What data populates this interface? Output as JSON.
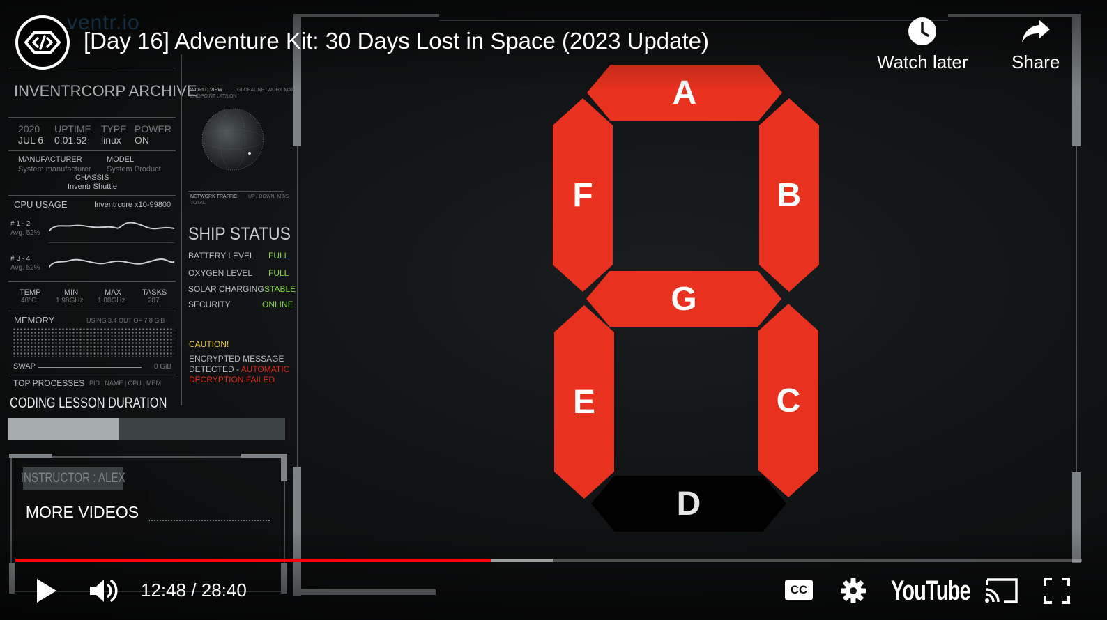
{
  "player": {
    "title": "[Day 16] Adventure Kit: 30 Days Lost in Space (2023 Update)",
    "watch_later_label": "Watch later",
    "share_label": "Share",
    "more_videos_label": "MORE VIDEOS",
    "current_time": "12:48",
    "duration": "28:40",
    "time_separator": " / ",
    "progress_played": 0.446,
    "progress_buffered": 0.504,
    "youtube_logo_text": "YouTube",
    "cc_label": "CC",
    "accent_color": "#ff0000"
  },
  "watermark": {
    "text": "ventr.io"
  },
  "hud": {
    "archive_title": "INVENTRCORP ARCHIVE",
    "stats": {
      "year": "2020",
      "date": "JUL 6",
      "uptime_label": "UPTIME",
      "uptime": "0:01:52",
      "type_label": "TYPE",
      "type": "linux",
      "power_label": "POWER",
      "power": "ON"
    },
    "manufacturer_label": "MANUFACTURER",
    "manufacturer": "System manufacturer",
    "model_label": "MODEL",
    "model": "System Product",
    "chassis_label": "CHASSIS",
    "chassis": "Inventr Shuttle",
    "cpu_usage_label": "CPU USAGE",
    "cpu_name": "Inventrcore x10-99800",
    "cpu_rows": [
      {
        "label": "# 1 - 2",
        "avg": "Avg. 52%"
      },
      {
        "label": "# 3 - 4",
        "avg": "Avg. 52%"
      }
    ],
    "temp_label": "TEMP",
    "temp": "48°C",
    "min_label": "MIN",
    "min": "1.98GHz",
    "max_label": "MAX",
    "max": "1.88GHz",
    "tasks_label": "TASKS",
    "tasks": "287",
    "memory_label": "MEMORY",
    "memory_usage": "USING 3.4 OUT OF 7.8 GiB",
    "swap_label": "SWAP",
    "swap_value": "0 GiB",
    "top_processes_label": "TOP PROCESSES",
    "top_processes_cols": "PID | NAME | CPU | MEM",
    "world_view_label": "WORLD VIEW",
    "endpoint_label": "ENDPOINT LAT/LON",
    "global_map_label": "GLOBAL NETWORK MAP",
    "network_traffic_label": "NETWORK TRAFFIC",
    "network_total_label": "TOTAL",
    "network_updown_label": "UP / DOWN, MB/S",
    "ship_status_title": "SHIP STATUS",
    "ship_status": [
      {
        "label": "BATTERY LEVEL",
        "value": "FULL"
      },
      {
        "label": "OXYGEN LEVEL",
        "value": "FULL"
      },
      {
        "label": "SOLAR CHARGING",
        "value": "STABLE"
      },
      {
        "label": "SECURITY",
        "value": "ONLINE"
      }
    ],
    "caution_label": "CAUTION!",
    "caution_line1": "ENCRYPTED MESSAGE",
    "caution_line2": "DETECTED - ",
    "caution_auto": "AUTOMATIC",
    "caution_failed": "DECRYPTION FAILED",
    "lesson_duration_label": "CODING LESSON DURATION",
    "lesson_progress": 0.4,
    "instructor_label": "INSTRUCTOR : ALEX"
  },
  "seven_segment": {
    "on_color": "#e8321f",
    "off_color": "#000000",
    "segments": [
      {
        "id": "A",
        "label": "A",
        "on": true
      },
      {
        "id": "B",
        "label": "B",
        "on": true
      },
      {
        "id": "C",
        "label": "C",
        "on": true
      },
      {
        "id": "D",
        "label": "D",
        "on": false
      },
      {
        "id": "E",
        "label": "E",
        "on": true
      },
      {
        "id": "F",
        "label": "F",
        "on": true
      },
      {
        "id": "G",
        "label": "G",
        "on": true
      }
    ]
  }
}
